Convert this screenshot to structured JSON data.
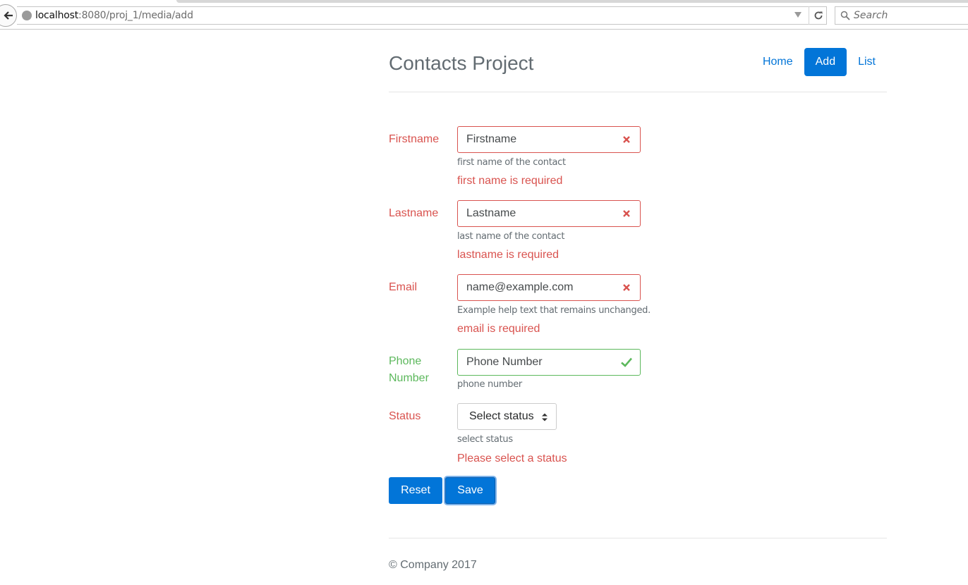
{
  "browser": {
    "url_host": "localhost",
    "url_rest": ":8080/proj_1/media/add",
    "search_placeholder": "Search"
  },
  "header": {
    "brand": "Contacts Project",
    "nav": [
      {
        "label": "Home",
        "active": false
      },
      {
        "label": "Add",
        "active": true
      },
      {
        "label": "List",
        "active": false
      }
    ]
  },
  "form": {
    "firstname": {
      "label": "Firstname",
      "placeholder": "Firstname",
      "help": "first name of the contact",
      "error": "first name is required",
      "state": "danger"
    },
    "lastname": {
      "label": "Lastname",
      "placeholder": "Lastname",
      "help": "last name of the contact",
      "error": "lastname is required",
      "state": "danger"
    },
    "email": {
      "label": "Email",
      "placeholder": "name@example.com",
      "help": "Example help text that remains unchanged.",
      "error": "email is required",
      "state": "danger"
    },
    "phone": {
      "label_line1": "Phone",
      "label_line2": "Number",
      "placeholder": "Phone Number",
      "help": "phone number",
      "state": "success"
    },
    "status": {
      "label": "Status",
      "selected": "Select status",
      "help": "select status",
      "error": "Please select a status",
      "state": "danger"
    },
    "reset_label": "Reset",
    "save_label": "Save"
  },
  "footer": {
    "copyright": "© Company 2017"
  },
  "colors": {
    "primary": "#0275d8",
    "danger": "#d9534f",
    "success": "#5cb85c"
  },
  "icons": {
    "back": "back-arrow-icon",
    "reload": "reload-icon",
    "search": "search-icon",
    "invalid": "close-icon",
    "valid": "check-icon"
  }
}
